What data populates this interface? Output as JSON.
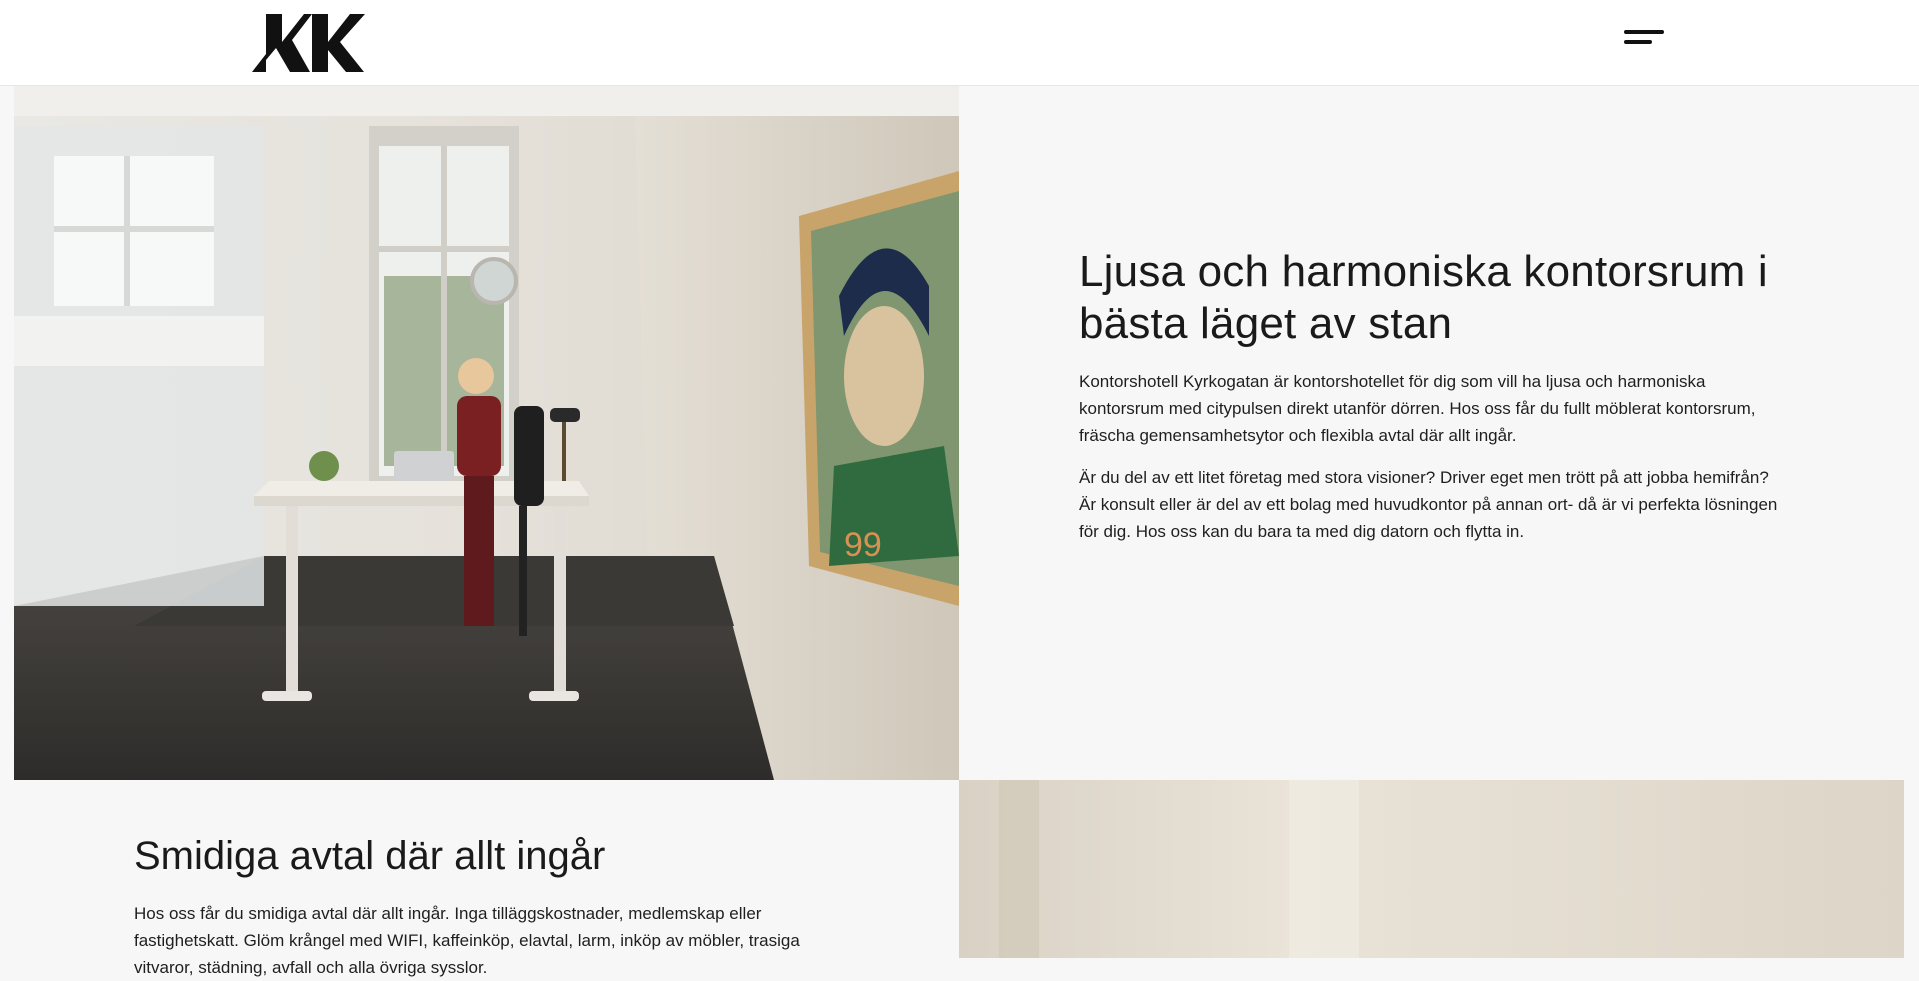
{
  "header": {
    "logo_alt": "KK",
    "menu_icon": "hamburger-menu-icon"
  },
  "section1": {
    "title": "Ljusa och harmoniska kontorsrum i bästa läget av stan",
    "paragraph1": "Kontorshotell Kyrkogatan är kontorshotellet för dig som vill ha ljusa och harmoniska kontorsrum med citypulsen direkt utanför dörren. Hos oss får du fullt möblerat kontorsrum, fräscha gemensamhetsytor och flexibla avtal där allt ingår.",
    "paragraph2": "Är du del av ett litet företag med stora visioner? Driver eget men trött på att jobba hemifrån? Är konsult eller är del av ett bolag med huvudkontor på annan ort- då är vi perfekta lösningen för dig. Hos oss kan du bara ta med dig datorn och flytta in.",
    "image_label": "office-photo"
  },
  "section2": {
    "title": "Smidiga avtal där allt ingår",
    "paragraph1": "Hos oss får du smidiga avtal där allt ingår. Inga tilläggskostnader, medlemskap eller fastighetskatt. Glöm krångel med WIFI, kaffeinköp, elavtal, larm, inköp av möbler, trasiga vitvaror, städning, avfall och alla övriga sysslor.",
    "image_label": "office-photo-2"
  },
  "colors": {
    "background": "#f7f7f7",
    "header_bg": "#ffffff",
    "text": "#1a1a1a"
  }
}
